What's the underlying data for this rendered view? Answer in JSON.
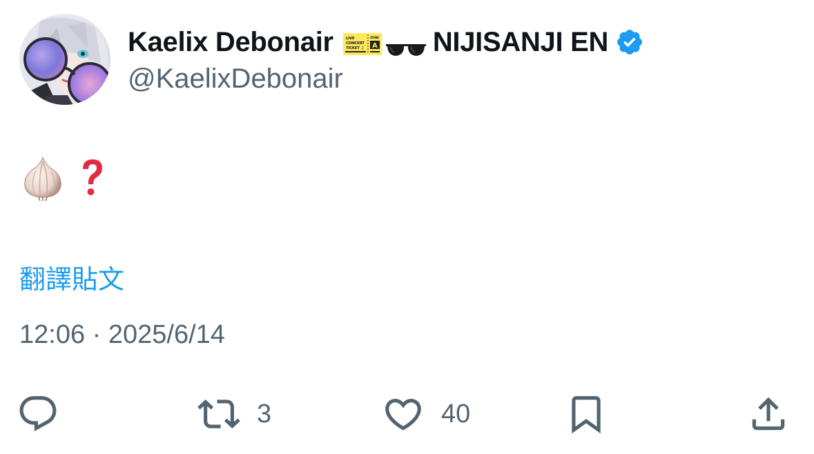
{
  "author": {
    "display_name": "Kaelix Debonair",
    "name_suffix": "NIJISANJI EN",
    "handle": "@KaelixDebonair",
    "verified": true,
    "badge_icons": [
      "concert-ticket-icon",
      "sunglasses-icon"
    ],
    "ticket_badge": {
      "line1": "LIVE",
      "line2": "CONCERT",
      "line3": "TICKET ♫",
      "zone": "ZONE",
      "zone_letter": "A"
    }
  },
  "tweet": {
    "content_icons": [
      "garlic-icon",
      "red-question-mark-icon"
    ],
    "translate_label": "翻譯貼文",
    "timestamp": "12:06 · 2025/6/14"
  },
  "actions": {
    "reply_count": "",
    "retweet_count": "3",
    "like_count": "40"
  },
  "colors": {
    "text": "#0f1419",
    "secondary": "#536471",
    "link": "#1d9bf0",
    "verified": "#1d9bf0"
  }
}
